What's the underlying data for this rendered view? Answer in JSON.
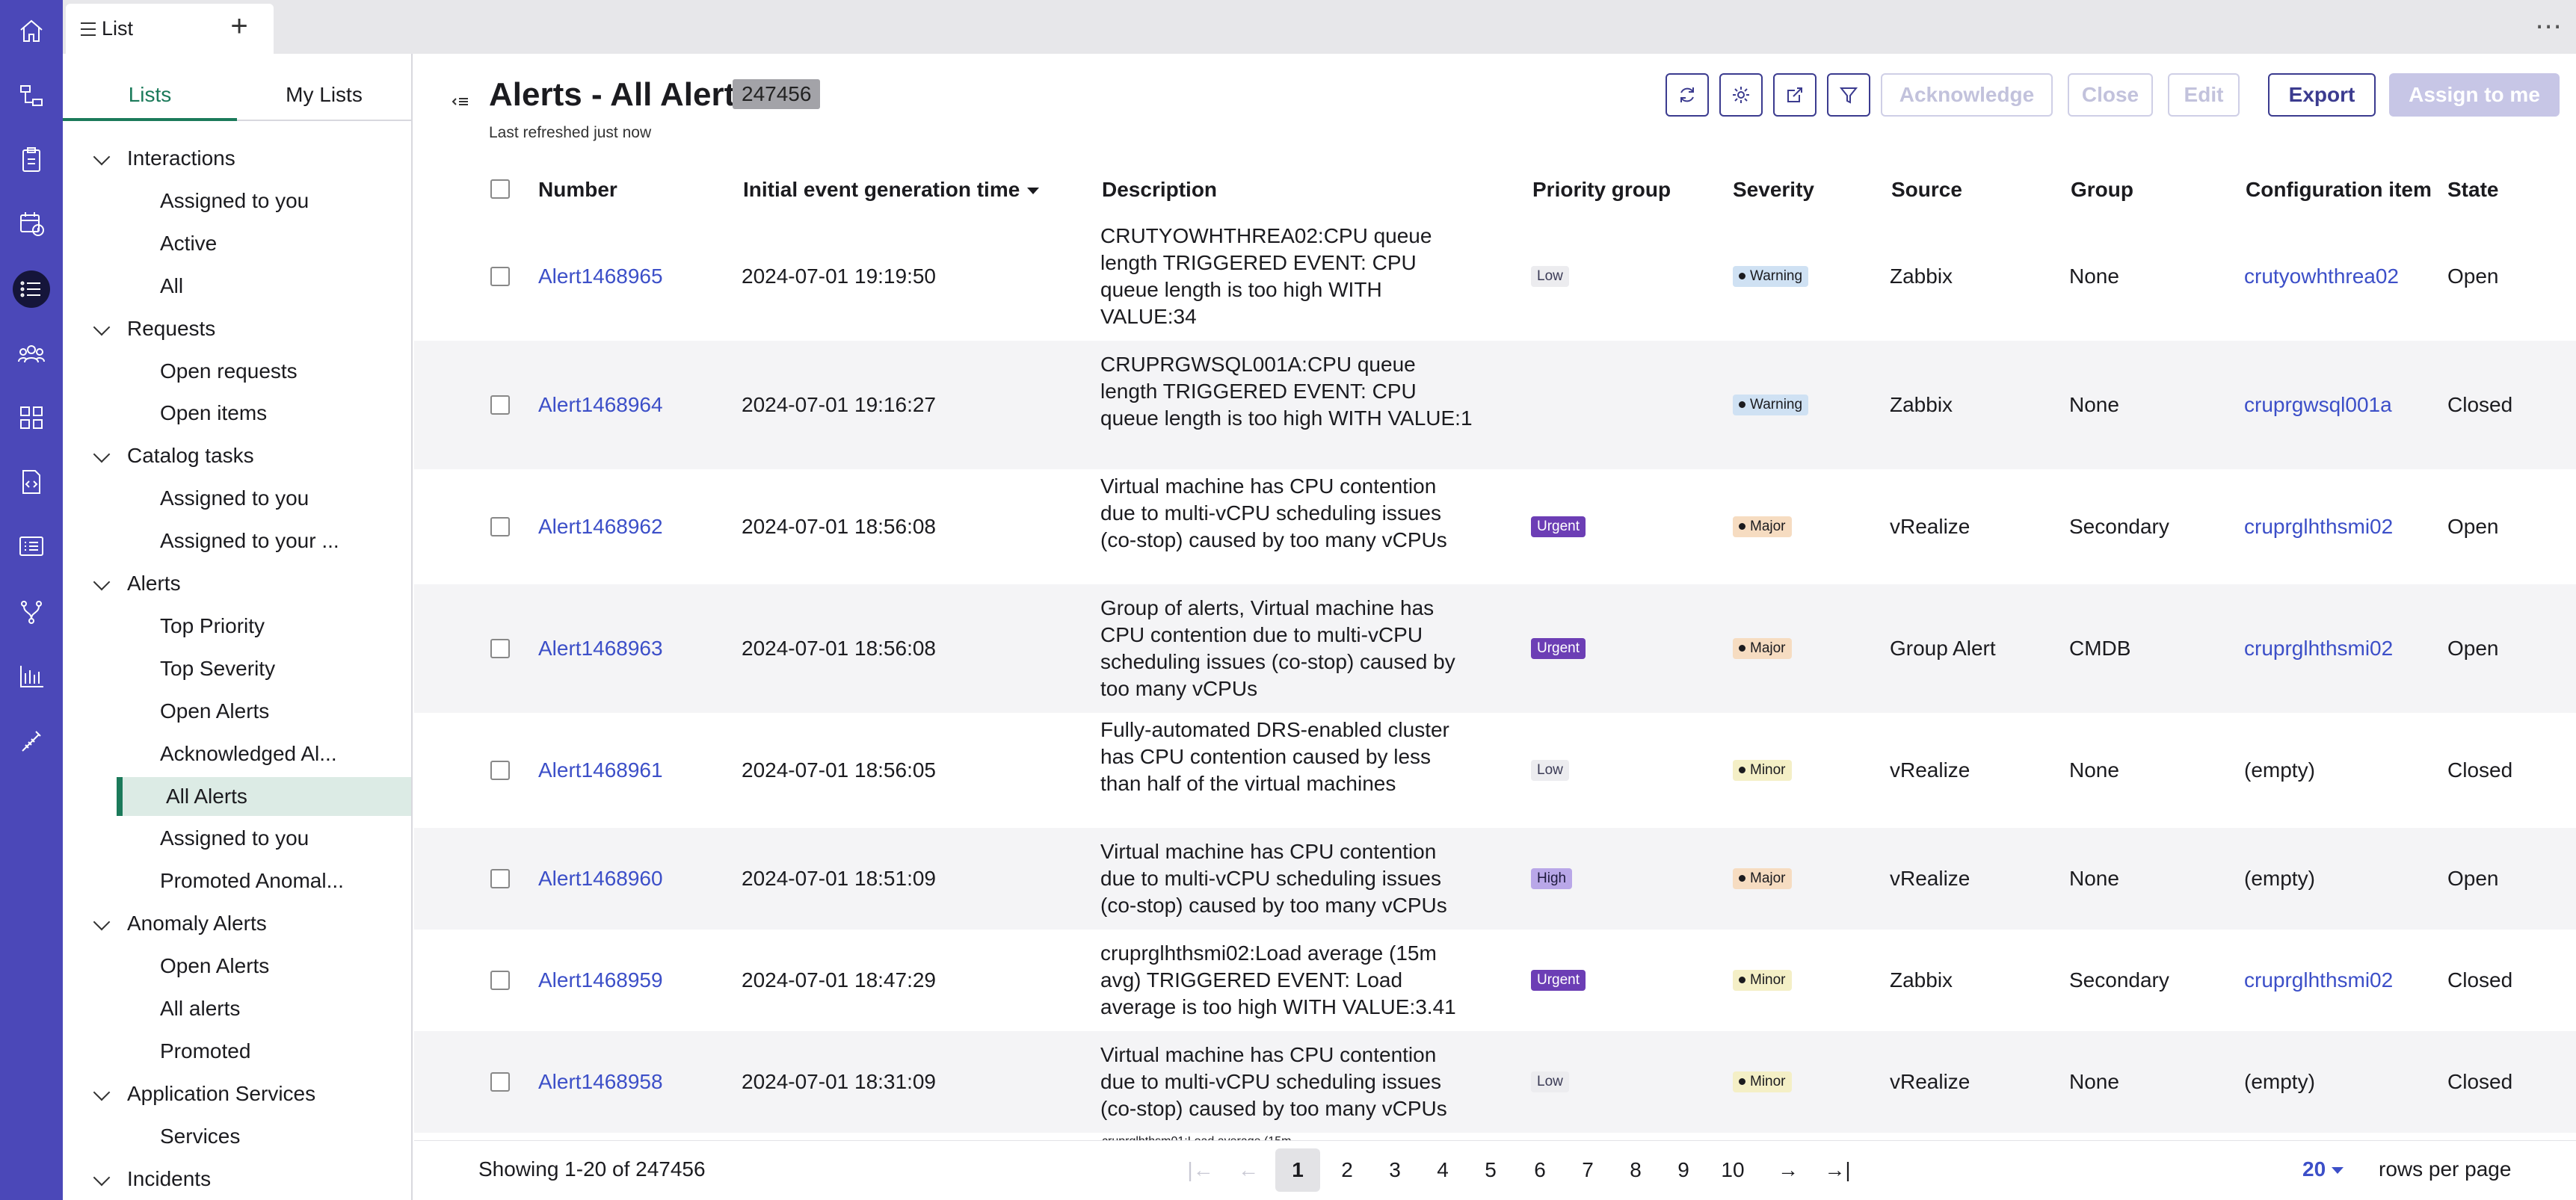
{
  "tabbar": {
    "tab_label": "List",
    "add_label": "+",
    "more_label": "⋯"
  },
  "sidebar": {
    "tabs": [
      "Lists",
      "My Lists"
    ],
    "items": [
      {
        "type": "group",
        "label": "Interactions"
      },
      {
        "type": "sub",
        "label": "Assigned to you"
      },
      {
        "type": "sub",
        "label": "Active"
      },
      {
        "type": "sub",
        "label": "All"
      },
      {
        "type": "group",
        "label": "Requests"
      },
      {
        "type": "sub",
        "label": "Open requests"
      },
      {
        "type": "sub",
        "label": "Open items"
      },
      {
        "type": "group",
        "label": "Catalog tasks"
      },
      {
        "type": "sub",
        "label": "Assigned to you"
      },
      {
        "type": "sub",
        "label": "Assigned to your ..."
      },
      {
        "type": "group",
        "label": "Alerts"
      },
      {
        "type": "sub",
        "label": "Top Priority"
      },
      {
        "type": "sub",
        "label": "Top Severity"
      },
      {
        "type": "sub",
        "label": "Open Alerts"
      },
      {
        "type": "sub",
        "label": "Acknowledged Al..."
      },
      {
        "type": "sub",
        "label": "All Alerts",
        "selected": true
      },
      {
        "type": "sub",
        "label": "Assigned to you"
      },
      {
        "type": "sub",
        "label": "Promoted Anomal..."
      },
      {
        "type": "group",
        "label": "Anomaly Alerts"
      },
      {
        "type": "sub",
        "label": "Open Alerts"
      },
      {
        "type": "sub",
        "label": "All alerts"
      },
      {
        "type": "sub",
        "label": "Promoted"
      },
      {
        "type": "group",
        "label": "Application Services"
      },
      {
        "type": "sub",
        "label": "Services"
      },
      {
        "type": "group",
        "label": "Incidents"
      }
    ]
  },
  "header": {
    "title": "Alerts - All Alerts",
    "count": "247456",
    "refreshed": "Last refreshed just now",
    "buttons": {
      "acknowledge": "Acknowledge",
      "close": "Close",
      "edit": "Edit",
      "export": "Export",
      "assign": "Assign to me"
    }
  },
  "table": {
    "columns": [
      "Number",
      "Initial event generation time",
      "Description",
      "Priority group",
      "Severity",
      "Source",
      "Group",
      "Configuration item",
      "State"
    ],
    "rows": [
      {
        "number": "Alert1468965",
        "time": "2024-07-01 19:19:50",
        "description": "CRUTYOWHTHREA02:CPU queue length TRIGGERED EVENT: CPU queue length is too high WITH VALUE:34",
        "priority": "Low",
        "severity": "Warning",
        "source": "Zabbix",
        "group": "None",
        "ci": "crutyowhthrea02",
        "ci_link": true,
        "state": "Open"
      },
      {
        "number": "Alert1468964",
        "time": "2024-07-01 19:16:27",
        "description": "CRUPRGWSQL001A:CPU queue length TRIGGERED EVENT: CPU queue length is too high WITH VALUE:1",
        "priority": "",
        "severity": "Warning",
        "source": "Zabbix",
        "group": "None",
        "ci": "cruprgwsql001a",
        "ci_link": true,
        "state": "Closed"
      },
      {
        "number": "Alert1468962",
        "time": "2024-07-01 18:56:08",
        "description": "Virtual machine has CPU contention due to multi-vCPU scheduling issues (co-stop) caused by too many vCPUs",
        "priority": "Urgent",
        "severity": "Major",
        "source": "vRealize",
        "group": "Secondary",
        "ci": "cruprglhthsmi02",
        "ci_link": true,
        "state": "Open"
      },
      {
        "number": "Alert1468963",
        "time": "2024-07-01 18:56:08",
        "description": "Group of alerts, Virtual machine has CPU contention due to multi-vCPU scheduling issues (co-stop) caused by too many vCPUs",
        "priority": "Urgent",
        "severity": "Major",
        "source": "Group Alert",
        "group": "CMDB",
        "ci": "cruprglhthsmi02",
        "ci_link": true,
        "state": "Open"
      },
      {
        "number": "Alert1468961",
        "time": "2024-07-01 18:56:05",
        "description": "Fully-automated DRS-enabled cluster has CPU contention caused by less than half of the virtual machines",
        "priority": "Low",
        "severity": "Minor",
        "source": "vRealize",
        "group": "None",
        "ci": "(empty)",
        "ci_link": false,
        "state": "Closed"
      },
      {
        "number": "Alert1468960",
        "time": "2024-07-01 18:51:09",
        "description": "Virtual machine has CPU contention due to multi-vCPU scheduling issues (co-stop) caused by too many vCPUs",
        "priority": "High",
        "severity": "Major",
        "source": "vRealize",
        "group": "None",
        "ci": "(empty)",
        "ci_link": false,
        "state": "Open"
      },
      {
        "number": "Alert1468959",
        "time": "2024-07-01 18:47:29",
        "description": "cruprglhthsmi02:Load average (15m avg) TRIGGERED EVENT: Load average is too high WITH VALUE:3.41",
        "priority": "Urgent",
        "severity": "Minor",
        "source": "Zabbix",
        "group": "Secondary",
        "ci": "cruprglhthsmi02",
        "ci_link": true,
        "state": "Closed"
      },
      {
        "number": "Alert1468958",
        "time": "2024-07-01 18:31:09",
        "description": "Virtual machine has CPU contention due to multi-vCPU scheduling issues (co-stop) caused by too many vCPUs",
        "priority": "Low",
        "severity": "Minor",
        "source": "vRealize",
        "group": "None",
        "ci": "(empty)",
        "ci_link": false,
        "state": "Closed"
      }
    ],
    "partial_row_text": "cruprglhthsm01:Load average (15m"
  },
  "footer": {
    "showing": "Showing 1-20 of 247456",
    "pages": [
      "1",
      "2",
      "3",
      "4",
      "5",
      "6",
      "7",
      "8",
      "9",
      "10"
    ],
    "current_page": "1",
    "rows_per_page_value": "20",
    "rows_per_page_label": "rows per page"
  },
  "colors": {
    "rail": "#4b48b8",
    "accent": "#1b7a5a",
    "link": "#3c4fc8",
    "button": "#3b3b8f"
  },
  "rail_icons": [
    "home-icon",
    "hierarchy-icon",
    "clipboard-icon",
    "calendar-clock-icon",
    "list-icon",
    "people-icon",
    "grid-icon",
    "code-doc-icon",
    "form-icon",
    "fork-icon",
    "bar-chart-icon",
    "magic-wand-icon"
  ]
}
